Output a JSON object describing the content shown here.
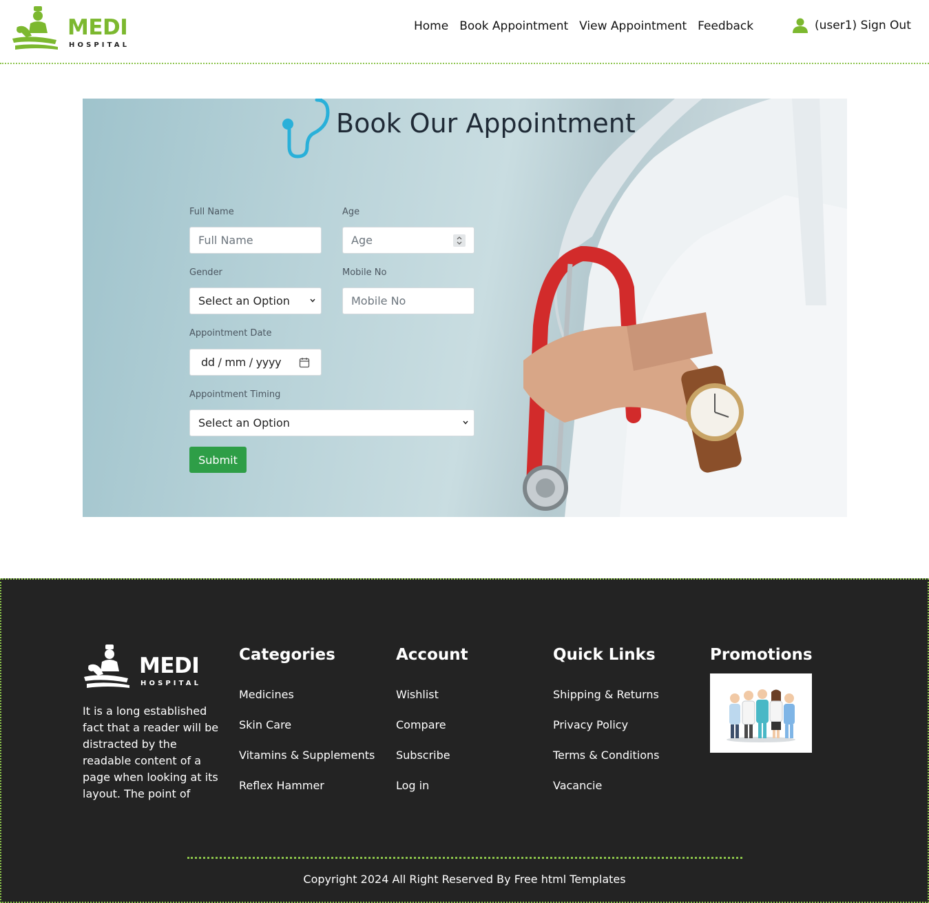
{
  "brand": {
    "name": "MEDI",
    "subtitle": "HOSPITAL",
    "accent_color": "#7cb82f"
  },
  "nav": {
    "items": [
      "Home",
      "Book Appointment",
      "View Appointment",
      "Feedback"
    ],
    "user_icon": "user-icon",
    "signout_label": "(user1) Sign Out"
  },
  "form": {
    "title": "Book Our Appointment",
    "title_icon": "stethoscope-icon",
    "full_name": {
      "label": "Full Name",
      "placeholder": "Full Name"
    },
    "age": {
      "label": "Age",
      "placeholder": "Age"
    },
    "gender": {
      "label": "Gender",
      "selected": "Select an Option"
    },
    "mobile": {
      "label": "Mobile No",
      "placeholder": "Mobile No"
    },
    "date": {
      "label": "Appointment Date",
      "placeholder": "dd / mm / yyyy",
      "icon": "calendar-icon"
    },
    "timing": {
      "label": "Appointment Timing",
      "selected": "Select an Option"
    },
    "submit_label": "Submit",
    "submit_color": "#2e9e47"
  },
  "footer": {
    "about": "It is a long established fact that a reader will be distracted by the readable content of a page when looking at its layout. The point of",
    "categories": {
      "title": "Categories",
      "links": [
        "Medicines",
        "Skin Care",
        "Vitamins & Supplements",
        "Reflex Hammer"
      ]
    },
    "account": {
      "title": "Account",
      "links": [
        "Wishlist",
        "Compare",
        "Subscribe",
        "Log in"
      ]
    },
    "quick_links": {
      "title": "Quick Links",
      "links": [
        "Shipping & Returns",
        "Privacy Policy",
        "Terms & Conditions",
        "Vacancie"
      ]
    },
    "promotions": {
      "title": "Promotions",
      "image": "doctors-team-illustration"
    },
    "copyright": "Copyright 2024 All Right Reserved By Free html Templates",
    "background_color": "#232323"
  }
}
